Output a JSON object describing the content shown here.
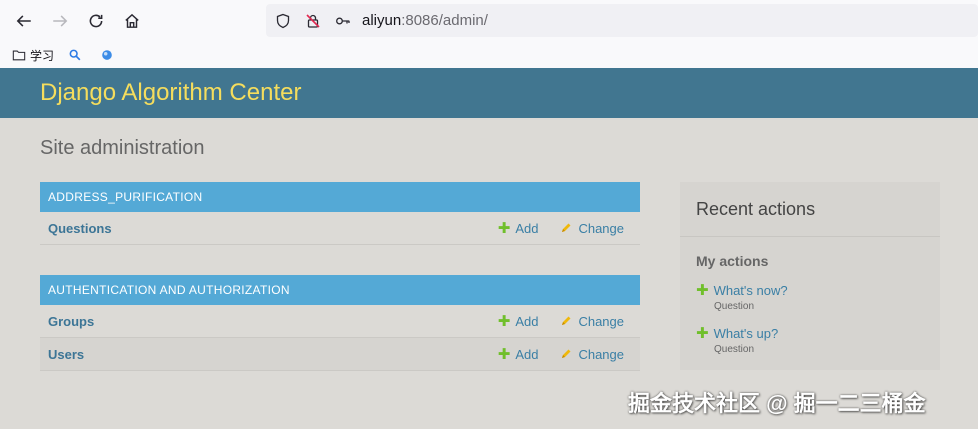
{
  "browser": {
    "url_host": "aliyun",
    "url_rest": ":8086/admin/",
    "bookmarks": [
      {
        "label": "学习"
      }
    ]
  },
  "header": {
    "brand": "Django Algorithm Center"
  },
  "page": {
    "title": "Site administration"
  },
  "modules": [
    {
      "caption": "ADDRESS_PURIFICATION",
      "rows": [
        {
          "model": "Questions",
          "add": "Add",
          "change": "Change"
        }
      ]
    },
    {
      "caption": "AUTHENTICATION AND AUTHORIZATION",
      "rows": [
        {
          "model": "Groups",
          "add": "Add",
          "change": "Change"
        },
        {
          "model": "Users",
          "add": "Add",
          "change": "Change"
        }
      ]
    }
  ],
  "recent_actions": {
    "title": "Recent actions",
    "my_actions_label": "My actions",
    "items": [
      {
        "label": "What's now?",
        "type": "Question"
      },
      {
        "label": "What's up?",
        "type": "Question"
      }
    ]
  },
  "watermark": "掘金技术社区 @ 掘一二三桶金",
  "colors": {
    "header_bg": "#417690",
    "brand": "#f5dd5d",
    "caption_bg": "#54a9d6",
    "link": "#3a7fa5",
    "add_icon": "#70bf2b",
    "change_icon": "#efb80b"
  }
}
